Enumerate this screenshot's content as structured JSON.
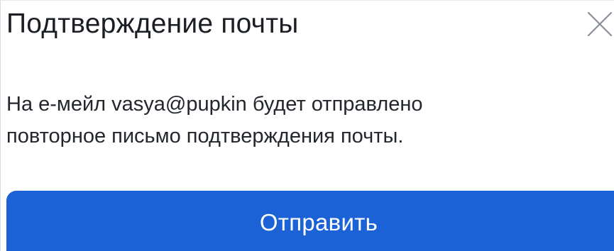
{
  "dialog": {
    "title": "Подтверждение почты",
    "close_icon": "close-icon",
    "message_lines": [
      "На е-мейл vasya@pupkin будет отправлено",
      "повторное письмо подтверждения почты."
    ],
    "submit_label": "Отправить"
  },
  "colors": {
    "primary_button": "#1b62d6",
    "button_text": "#ffffff",
    "title_text": "#1b1f24",
    "body_text": "#23272d",
    "close_icon": "#8a9099"
  }
}
